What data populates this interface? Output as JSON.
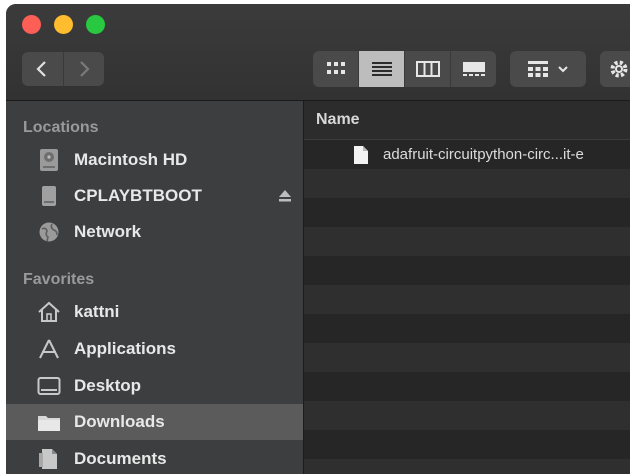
{
  "toolbar": {
    "back_icon": "chevron-left-icon",
    "forward_icon": "chevron-right-icon",
    "views": [
      "icon-view-icon",
      "list-view-icon",
      "column-view-icon",
      "gallery-view-icon"
    ],
    "active_view": "list-view-icon"
  },
  "sidebar": {
    "locations_header": "Locations",
    "locations": [
      {
        "label": "Macintosh HD",
        "icon": "hard-drive-icon"
      },
      {
        "label": "CPLAYBTBOOT",
        "icon": "external-drive-icon"
      },
      {
        "label": "Network",
        "icon": "network-globe-icon"
      }
    ],
    "favorites_header": "Favorites",
    "favorites": [
      {
        "label": "kattni",
        "icon": "home-icon"
      },
      {
        "label": "Applications",
        "icon": "applications-icon"
      },
      {
        "label": "Desktop",
        "icon": "desktop-icon"
      },
      {
        "label": "Downloads",
        "icon": "downloads-folder-icon",
        "selected": true
      },
      {
        "label": "Documents",
        "icon": "documents-icon"
      }
    ]
  },
  "list": {
    "column_name": "Name",
    "files": [
      {
        "name": "adafruit-circuitpython-circ...it-e",
        "icon": "document-icon"
      }
    ]
  }
}
